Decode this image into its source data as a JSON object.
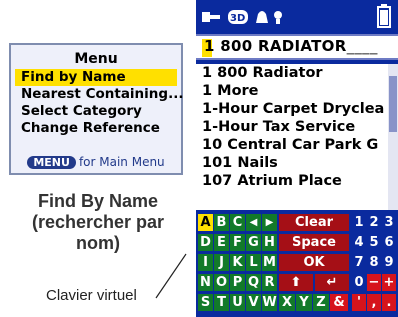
{
  "menu": {
    "title": "Menu",
    "items": [
      "Find by Name",
      "Nearest Containing...",
      "Select Category",
      "Change Reference"
    ],
    "footer_button": "MENU",
    "footer_text": "for Main Menu"
  },
  "caption": {
    "line1": "Find By Name",
    "line2": "(rechercher par",
    "line3": "nom)"
  },
  "keyboard_label": "Clavier virtuel",
  "gps": {
    "search": {
      "cursor": "1",
      "value": " 800 RADIATOR",
      "placeholder": "____"
    },
    "results": [
      "1 800 Radiator",
      "1 More",
      "1-Hour Carpet Dryclea",
      "1-Hour Tax Service",
      "10 Central Car Park G",
      "101 Nails",
      "107 Atrium Place"
    ],
    "keys": {
      "row1": [
        "A",
        "B",
        "C",
        "◀",
        "▶"
      ],
      "row2": [
        "D",
        "E",
        "F",
        "G",
        "H"
      ],
      "row3": [
        "I",
        "J",
        "K",
        "L",
        "M"
      ],
      "row4": [
        "N",
        "O",
        "P",
        "Q",
        "R"
      ],
      "row5": [
        "S",
        "T",
        "U",
        "V",
        "W",
        "X",
        "Y",
        "Z",
        "&"
      ],
      "clear": "Clear",
      "space": "Space",
      "ok": "OK",
      "shift": "⬆",
      "enter": "↵",
      "n1": [
        "1",
        "2",
        "3"
      ],
      "n2": [
        "4",
        "5",
        "6"
      ],
      "n3": [
        "7",
        "8",
        "9"
      ],
      "n4": [
        "0",
        "−",
        "+"
      ],
      "n5": [
        "'",
        ",",
        "."
      ]
    }
  }
}
